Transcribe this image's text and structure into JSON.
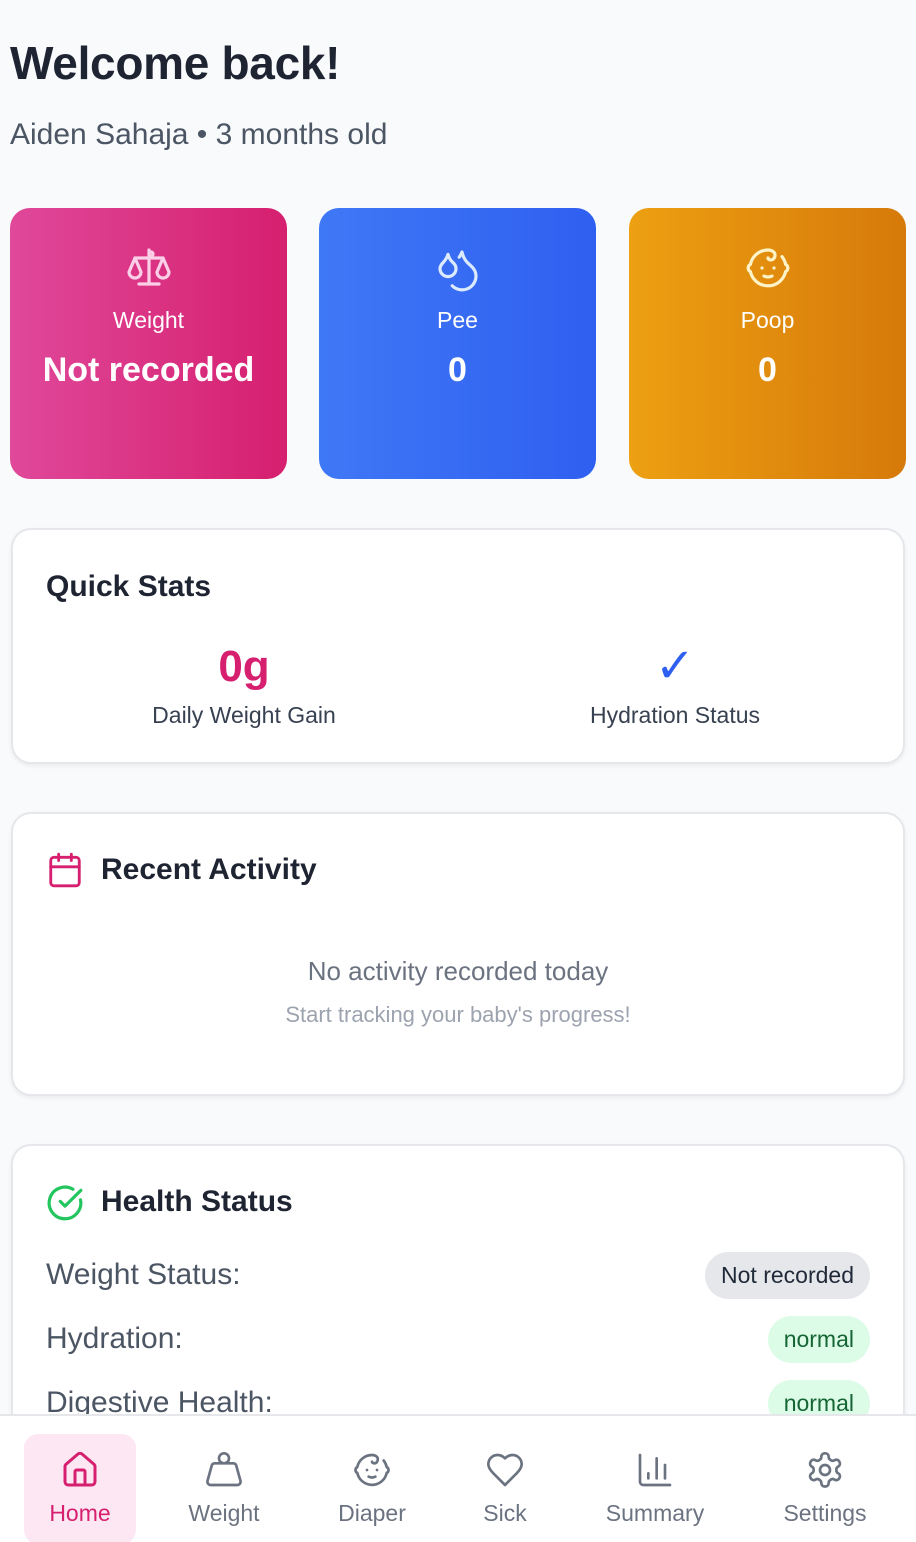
{
  "header": {
    "greeting": "Welcome back!",
    "subtitle": "Aiden Sahaja • 3 months old"
  },
  "stat_cards": [
    {
      "icon": "scale-icon",
      "label": "Weight",
      "value": "Not recorded",
      "color": "#d61f6f"
    },
    {
      "icon": "droplets-icon",
      "label": "Pee",
      "value": "0",
      "color": "#2f5ff0"
    },
    {
      "icon": "baby-face-icon",
      "label": "Poop",
      "value": "0",
      "color": "#d6790a"
    }
  ],
  "quick_stats": {
    "title": "Quick Stats",
    "daily_weight_gain": {
      "value": "0g",
      "label": "Daily Weight Gain"
    },
    "hydration": {
      "value": "✓",
      "label": "Hydration Status"
    }
  },
  "recent_activity": {
    "title": "Recent Activity",
    "icon": "calendar-icon",
    "empty_message": "No activity recorded today",
    "empty_hint": "Start tracking your baby's progress!"
  },
  "health_status": {
    "title": "Health Status",
    "icon": "check-circle-icon",
    "rows": [
      {
        "label": "Weight Status:",
        "badge": "Not recorded",
        "tone": "gray"
      },
      {
        "label": "Hydration:",
        "badge": "normal",
        "tone": "green"
      },
      {
        "label": "Digestive Health:",
        "badge": "normal",
        "tone": "green"
      }
    ]
  },
  "nav": [
    {
      "label": "Home",
      "icon": "home-icon",
      "active": true
    },
    {
      "label": "Weight",
      "icon": "weight-icon",
      "active": false
    },
    {
      "label": "Diaper",
      "icon": "baby-face-icon",
      "active": false
    },
    {
      "label": "Sick",
      "icon": "heart-icon",
      "active": false
    },
    {
      "label": "Summary",
      "icon": "bar-chart-icon",
      "active": false
    },
    {
      "label": "Settings",
      "icon": "gear-icon",
      "active": false
    }
  ],
  "colors": {
    "accent": "#d61f6f",
    "blue": "#2f5ff0",
    "amber": "#d6790a",
    "green": "#22c55e"
  }
}
